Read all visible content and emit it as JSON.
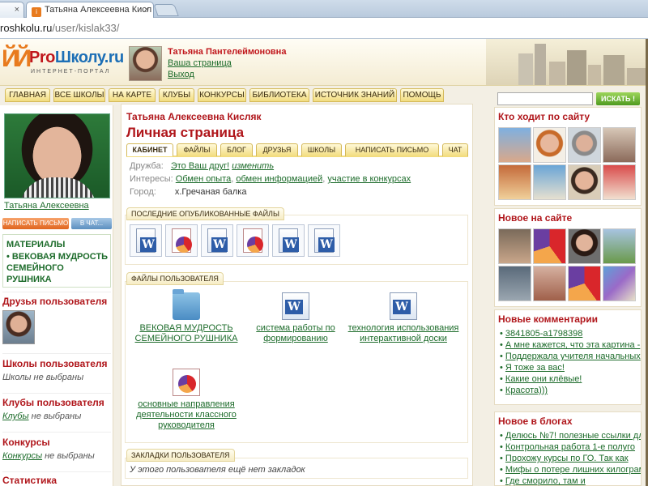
{
  "browser": {
    "tab1_close": "×",
    "tab2_title": "Татьяна Алексеевна Кисл",
    "tab2_close": "×",
    "url_host": "roshkolu.ru",
    "url_path": "/user/kislak33/"
  },
  "header": {
    "logo_pro": "Pro",
    "logo_rest": "Школу.ru",
    "logo_sub": "ИНТЕРНЕТ-ПОРТАЛ",
    "user_name": "Татьяна Пантелеймоновна",
    "your_page": "Ваша страница",
    "logout": "Выход"
  },
  "nav": [
    "ГЛАВНАЯ",
    "ВСЕ ШКОЛЫ",
    "НА КАРТЕ",
    "КЛУБЫ",
    "КОНКУРСЫ",
    "БИБЛИОТЕКА",
    "ИСТОЧНИК ЗНАНИЙ",
    "ПОМОЩЬ"
  ],
  "search": {
    "button": "ИСКАТЬ !"
  },
  "left": {
    "photo_caption": "Татьяна Алексеевна",
    "msg_button": "НАПИСАТЬ ПИСЬМО",
    "chat_button": "В ЧАТ...",
    "materials_title": "МАТЕРИАЛЫ",
    "materials_item": "• ВЕКОВАЯ МУДРОСТЬ СЕМЕЙНОГО РУШНИКА",
    "friends_title": "Друзья пользователя",
    "schools_title": "Школы пользователя",
    "schools_text": "Школы не выбраны",
    "clubs_title": "Клубы пользователя",
    "clubs_link": "Клубы",
    "clubs_rest": " не выбраны",
    "contests_title": "Конкурсы",
    "contests_link": "Конкурсы",
    "contests_rest": " не выбраны",
    "stats_title": "Статистика"
  },
  "center": {
    "full_name": "Татьяна Алексеевна Кисляк",
    "page_title": "Личная страница",
    "tabs": [
      "КАБИНЕТ",
      "ФАЙЛЫ",
      "БЛОГ",
      "ДРУЗЬЯ",
      "ШКОЛЫ",
      "НАПИСАТЬ ПИСЬМО",
      "ЧАТ"
    ],
    "friendship_label": "Дружба:",
    "friendship_value": "Это Ваш друг!",
    "friendship_change": "изменить",
    "interests_label": "Интересы:",
    "interest_1": "Обмен опыта",
    "interest_2": "обмен информацией",
    "interest_3": "участие в конкурсах",
    "city_label": "Город:",
    "city_value": "х.Гречаная балка",
    "recent_files_title": "ПОСЛЕДНИЕ ОПУБЛИКОВАННЫЕ ФАЙЛЫ",
    "recent_files": [
      "word",
      "ppt",
      "word",
      "ppt",
      "word",
      "word"
    ],
    "user_files_title": "ФАЙЛЫ ПОЛЬЗОВАТЕЛЯ",
    "files": [
      {
        "icon": "folder",
        "name": "ВЕКОВАЯ МУДРОСТЬ СЕМЕЙНОГО РУШНИКА"
      },
      {
        "icon": "word",
        "name": "система работы по формированию"
      },
      {
        "icon": "word",
        "name": "технология использования интерактивной доски"
      },
      {
        "icon": "ppt",
        "name": "основные направления деятельности классного руководителя"
      }
    ],
    "bookmarks_title": "ЗАКЛАДКИ ПОЛЬЗОВАТЕЛЯ",
    "bookmarks_empty": "У этого пользователя ещё нет закладок"
  },
  "right": {
    "visitors_title": "Кто ходит по сайту",
    "new_title": "Новое на сайте",
    "comments_title": "Новые комментарии",
    "comments": [
      "3841805-a1798398",
      "А мне кажется, что эта картина -",
      "Поддержала учителя начальных",
      "Я тоже за вас!",
      "Какие они клёвые!",
      "Красота)))"
    ],
    "blogs_title": "Новое в блогах",
    "blogs": [
      "Делюсь №7! полезные ссылки дл",
      "Контрольная работа 1-е полуго",
      "Прохожу курсы по ГО. Так как",
      "Мифы о потере лишних килограм",
      "Где сморило, там и"
    ]
  },
  "colors": {
    "accent_red": "#b0161b",
    "link_green": "#1c6b2a",
    "tab_yellow": "#f2dc7e"
  }
}
